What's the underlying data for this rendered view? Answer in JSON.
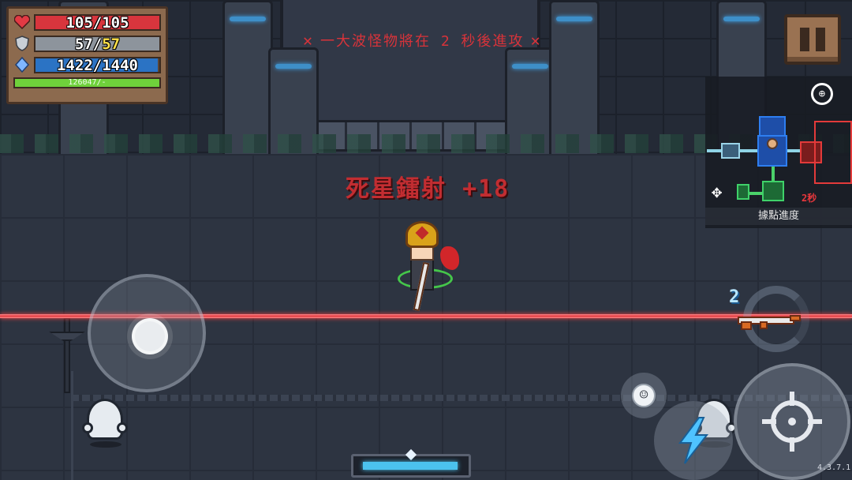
{
  "hud": {
    "hp_text": "105/105",
    "hp_fraction": 1.0,
    "armor_current": "57",
    "armor_max": "57",
    "armor_fraction": 1.0,
    "mana_text": "1422/1440",
    "mana_fraction": 0.9875,
    "energy_text": "126047/-",
    "energy_fraction": 1.0,
    "colors": {
      "hp": "#d8353d",
      "armor": "#8d949c",
      "mana": "#2b73c4",
      "energy": "#6fd13b"
    }
  },
  "wave_banner": {
    "text": "一大波怪物將在 2 秒後進攻",
    "color": "#d8333a"
  },
  "combat_text": {
    "label": "死星鐳射",
    "value": "+18"
  },
  "minimap": {
    "label": "據點進度",
    "timer": "2秒"
  },
  "weapon": {
    "ammo_badge": "2"
  },
  "version": "4.3.7.1",
  "icons": {
    "heart": "heart-icon",
    "shield": "shield-icon",
    "diamond": "mana-diamond-icon",
    "pause": "pause-icon",
    "globe": "globe-icon",
    "emote": "smiley-icon",
    "skill": "lightning-icon",
    "attack": "crosshair-icon"
  }
}
